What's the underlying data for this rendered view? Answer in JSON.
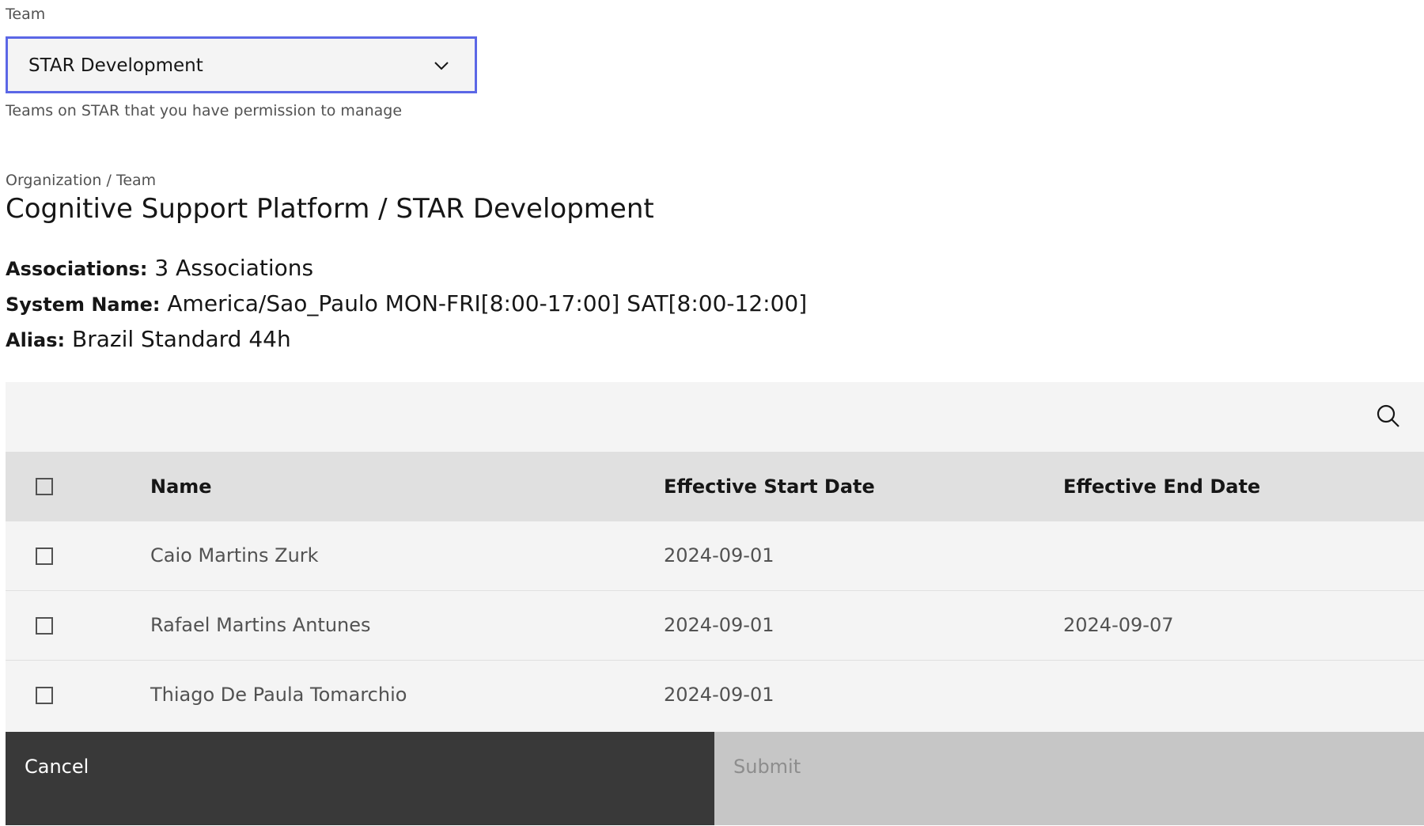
{
  "team_field": {
    "label": "Team",
    "selected_value": "STAR Development",
    "helper_text": "Teams on STAR that you have permission to manage"
  },
  "heading": {
    "breadcrumb": "Organization / Team",
    "title": "Cognitive Support Platform / STAR Development"
  },
  "details": {
    "associations_label": "Associations:",
    "associations_value": "3 Associations",
    "system_name_label": "System Name:",
    "system_name_value": "America/Sao_Paulo MON-FRI[8:00-17:00] SAT[8:00-12:00]",
    "alias_label": "Alias:",
    "alias_value": "Brazil Standard 44h"
  },
  "table": {
    "columns": [
      "Name",
      "Effective Start Date",
      "Effective End Date"
    ],
    "rows": [
      {
        "name": "Caio Martins Zurk",
        "start": "2024-09-01",
        "end": ""
      },
      {
        "name": "Rafael Martins Antunes",
        "start": "2024-09-01",
        "end": "2024-09-07"
      },
      {
        "name": "Thiago De Paula Tomarchio",
        "start": "2024-09-01",
        "end": ""
      }
    ]
  },
  "actions": {
    "cancel_label": "Cancel",
    "submit_label": "Submit"
  },
  "colors": {
    "focus_border": "#5b67e6",
    "cancel_bg": "#393939",
    "submit_disabled_bg": "#c6c6c6"
  },
  "icons": {
    "dropdown": "chevron-down-icon",
    "search": "search-icon"
  }
}
